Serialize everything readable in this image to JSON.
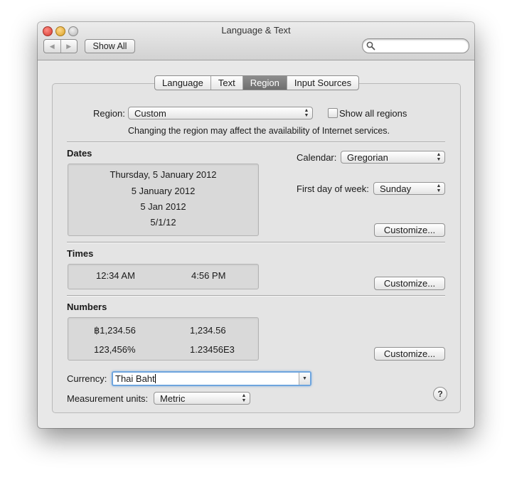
{
  "window": {
    "title": "Language & Text"
  },
  "toolbar": {
    "back_icon": "◀",
    "forward_icon": "▶",
    "show_all": "Show All",
    "search_placeholder": ""
  },
  "tabs": [
    {
      "label": "Language",
      "active": false
    },
    {
      "label": "Text",
      "active": false
    },
    {
      "label": "Region",
      "active": true
    },
    {
      "label": "Input Sources",
      "active": false
    }
  ],
  "region": {
    "label": "Region:",
    "value": "Custom",
    "show_all_label": "Show all regions",
    "show_all_checked": false,
    "notice": "Changing the region may affect the availability of Internet services."
  },
  "dates": {
    "heading": "Dates",
    "samples": [
      "Thursday, 5 January 2012",
      "5 January 2012",
      "5 Jan 2012",
      "5/1/12"
    ],
    "calendar_label": "Calendar:",
    "calendar_value": "Gregorian",
    "first_day_label": "First day of week:",
    "first_day_value": "Sunday",
    "customize": "Customize..."
  },
  "times": {
    "heading": "Times",
    "short": "12:34 AM",
    "long": "4:56 PM",
    "customize": "Customize..."
  },
  "numbers": {
    "heading": "Numbers",
    "currency_sample": "฿1,234.56",
    "decimal_sample": "1,234.56",
    "percent_sample": "123,456%",
    "scientific_sample": "1.23456E3",
    "customize": "Customize..."
  },
  "currency": {
    "label": "Currency:",
    "value": "Thai Baht"
  },
  "measurement": {
    "label": "Measurement units:",
    "value": "Metric"
  },
  "help": {
    "label": "?"
  },
  "colors": {
    "active_tab": "#7a7a7a",
    "focus_ring": "#6ea5de"
  }
}
